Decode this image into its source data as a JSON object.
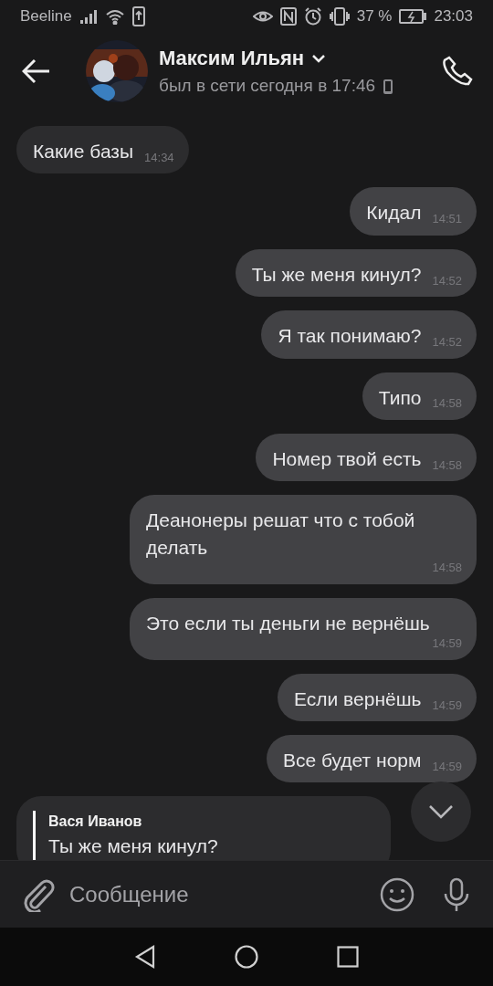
{
  "status_bar": {
    "carrier": "Beeline",
    "battery_percent": "37 %",
    "time": "23:03"
  },
  "header": {
    "name": "Максим Ильян",
    "last_seen": "был в сети сегодня в 17:46"
  },
  "messages": [
    {
      "kind": "text",
      "outgoing": false,
      "text": "Какие базы",
      "time": "14:34"
    },
    {
      "kind": "text",
      "outgoing": true,
      "text": "Кидал",
      "time": "14:51"
    },
    {
      "kind": "text",
      "outgoing": true,
      "text": "Ты же меня кинул?",
      "time": "14:52"
    },
    {
      "kind": "text",
      "outgoing": true,
      "text": "Я так понимаю?",
      "time": "14:52"
    },
    {
      "kind": "text",
      "outgoing": true,
      "text": "Типо",
      "time": "14:58"
    },
    {
      "kind": "text",
      "outgoing": true,
      "text": "Номер твой есть",
      "time": "14:58"
    },
    {
      "kind": "text",
      "outgoing": true,
      "text": "Деанонеры решат что с тобой делать",
      "time": "14:58"
    },
    {
      "kind": "text",
      "outgoing": true,
      "text": "Это если ты деньги не вернёшь",
      "time": "14:59"
    },
    {
      "kind": "text",
      "outgoing": true,
      "text": "Если вернёшь",
      "time": "14:59"
    },
    {
      "kind": "text",
      "outgoing": true,
      "text": "Все будет норм",
      "time": "14:59"
    },
    {
      "kind": "reply",
      "outgoing": false,
      "quote_author": "Вася Иванов",
      "quote_text": "Ты же меня кинул?"
    }
  ],
  "composer": {
    "placeholder": "Сообщение"
  }
}
